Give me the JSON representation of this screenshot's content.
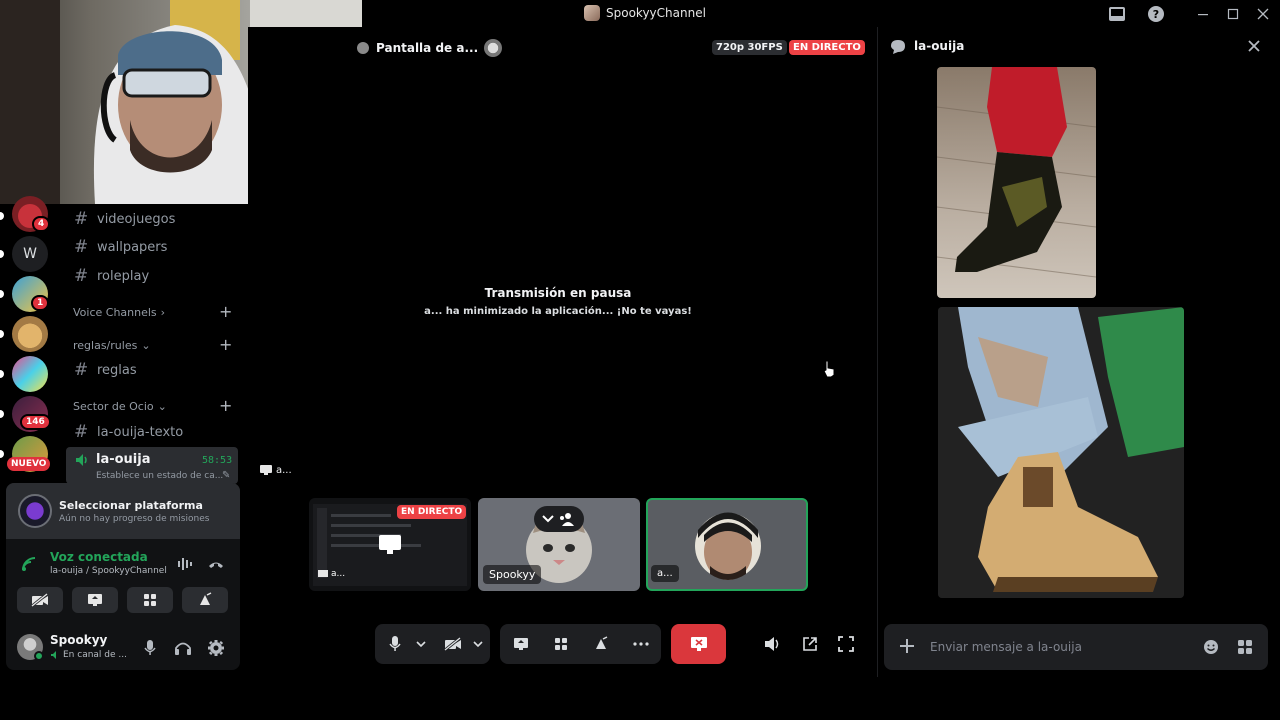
{
  "window": {
    "title": "SpookyyChannel"
  },
  "rail": {
    "badges": [
      "4",
      "1",
      "146"
    ],
    "letter": "W",
    "new_label": "NUEVO"
  },
  "channels": {
    "items": [
      {
        "label": "videojuegos"
      },
      {
        "label": "wallpapers"
      },
      {
        "label": "roleplay"
      }
    ],
    "voice_category": "Voice Channels",
    "rules_category": "reglas/rules",
    "rules_channel": "reglas",
    "ocio_category": "Sector de Ocio",
    "ocio_text": "la-ouija-texto",
    "voice_active": {
      "label": "la-ouija",
      "timer": "58:53",
      "status": "Establece un estado de ca..."
    }
  },
  "quest": {
    "title": "Seleccionar plataforma",
    "subtitle": "Aún no hay progreso de misiones"
  },
  "voice": {
    "status": "Voz conectada",
    "location": "la-ouija / SpookyyChannel"
  },
  "user": {
    "name": "Spookyy",
    "status": "En canal de ..."
  },
  "stage": {
    "stream_title": "Pantalla de a...",
    "quality": "720p 30FPS",
    "live": "EN DIRECTO",
    "paused_title": "Transmisión en pausa",
    "paused_sub": "a... ha minimizado la aplicación... ¡No te vayas!",
    "stream_owner": "a...",
    "tiles": [
      {
        "name": "a...",
        "live": "EN DIRECTO"
      },
      {
        "name": "Spookyy"
      },
      {
        "name": "a..."
      }
    ]
  },
  "chat": {
    "channel": "la-ouija",
    "placeholder": "Enviar mensaje a la-ouija"
  },
  "colors": {
    "accent_green": "#23a55a",
    "danger": "#da373c",
    "live_red": "#ed4245"
  }
}
